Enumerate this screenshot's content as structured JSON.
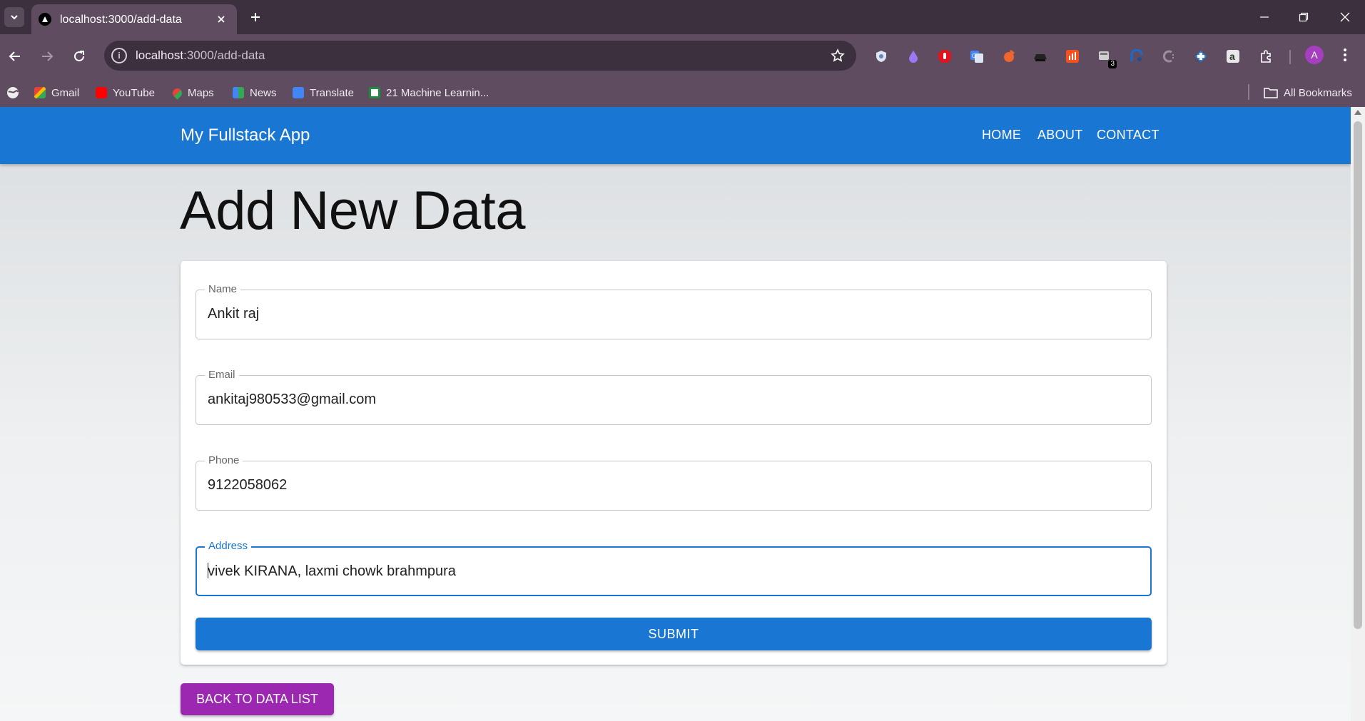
{
  "browser": {
    "tab_title": "localhost:3000/add-data",
    "url_host": "localhost",
    "url_path": ":3000/add-data",
    "extension_badge": "3",
    "profile_initial": "A",
    "bookmarks": [
      {
        "label": "Gmail",
        "icon": "gmail-icon",
        "color": "#ea4335"
      },
      {
        "label": "YouTube",
        "icon": "youtube-icon",
        "color": "#ff0000"
      },
      {
        "label": "Maps",
        "icon": "maps-icon",
        "color": "#34a853"
      },
      {
        "label": "News",
        "icon": "news-icon",
        "color": "#4285f4"
      },
      {
        "label": "Translate",
        "icon": "translate-icon",
        "color": "#4285f4"
      },
      {
        "label": "21 Machine Learnin...",
        "icon": "bookmark-favicon-icon",
        "color": "#1e8e3e"
      }
    ],
    "all_bookmarks": "All Bookmarks"
  },
  "app": {
    "brand": "My Fullstack App",
    "nav": [
      "HOME",
      "ABOUT",
      "CONTACT"
    ],
    "accent": "#1976d2",
    "secondary": "#9c27b0"
  },
  "page": {
    "title": "Add New Data"
  },
  "form": {
    "name_label": "Name",
    "name_value": "Ankit raj",
    "email_label": "Email",
    "email_value": "ankitaj980533@gmail.com",
    "phone_label": "Phone",
    "phone_value": "9122058062",
    "address_label": "Address",
    "address_value": "vivek KIRANA, laxmi chowk brahmpura",
    "submit_label": "SUBMIT"
  },
  "back_button": "BACK TO DATA LIST"
}
